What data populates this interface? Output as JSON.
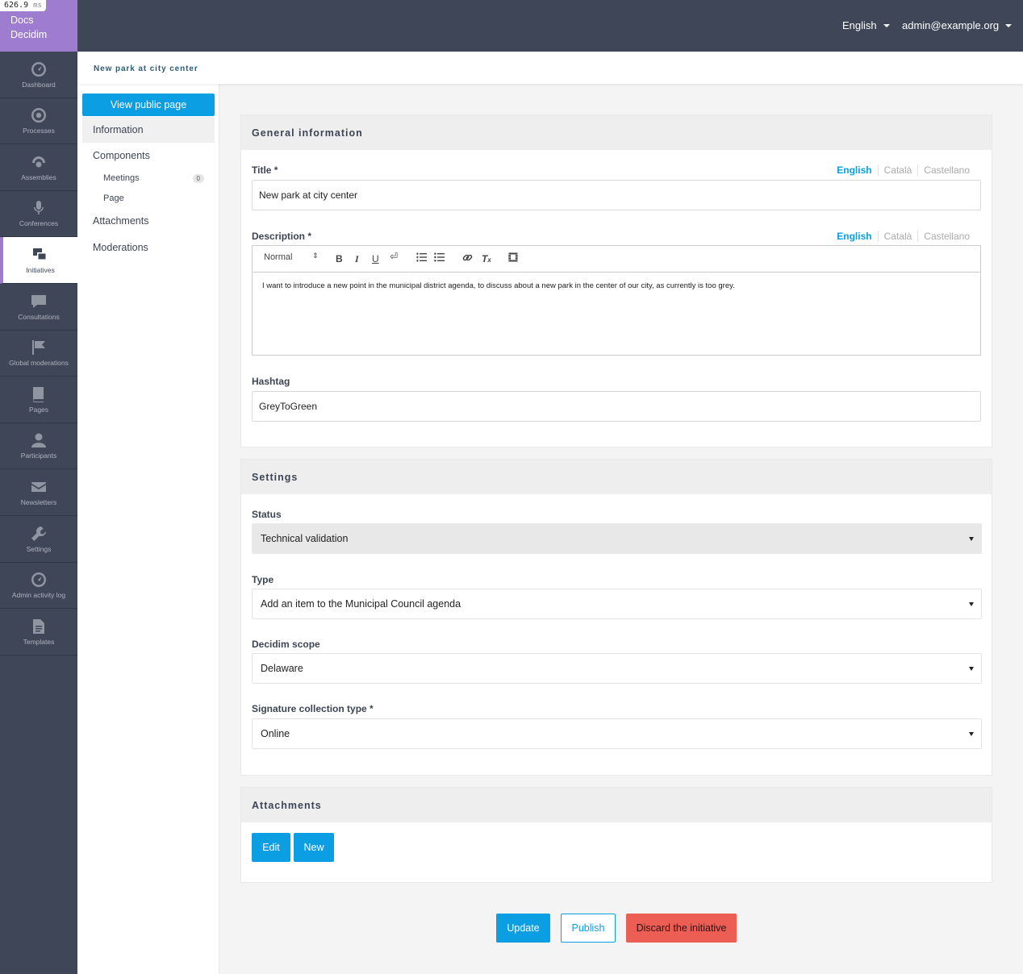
{
  "timing": {
    "value": "626.9",
    "unit": "ms"
  },
  "brand": {
    "line1": "Docs",
    "line2": "Decidim"
  },
  "rail": [
    {
      "label": "Dashboard",
      "icon": "dashboard-icon"
    },
    {
      "label": "Processes",
      "icon": "target-icon"
    },
    {
      "label": "Assemblies",
      "icon": "assembly-icon"
    },
    {
      "label": "Conferences",
      "icon": "microphone-icon"
    },
    {
      "label": "Initiatives",
      "icon": "initiatives-icon",
      "active": true
    },
    {
      "label": "Consultations",
      "icon": "chat-icon"
    },
    {
      "label": "Global moderations",
      "icon": "flag-icon"
    },
    {
      "label": "Pages",
      "icon": "book-icon"
    },
    {
      "label": "Participants",
      "icon": "person-icon"
    },
    {
      "label": "Newsletters",
      "icon": "envelope-icon"
    },
    {
      "label": "Settings",
      "icon": "wrench-icon"
    },
    {
      "label": "Admin activity log",
      "icon": "dashboard-icon"
    },
    {
      "label": "Templates",
      "icon": "document-icon"
    }
  ],
  "topbar": {
    "language": "English",
    "user": "admin@example.org"
  },
  "breadcrumb": "New park at city center",
  "subnav": {
    "public_button": "View public page",
    "information": "Information",
    "components": "Components",
    "meetings": "Meetings",
    "meetings_count": "0",
    "page": "Page",
    "attachments": "Attachments",
    "moderations": "Moderations"
  },
  "general": {
    "heading": "General information",
    "title_label": "Title *",
    "title_value": "New park at city center",
    "description_label": "Description *",
    "languages": [
      "English",
      "Català",
      "Castellano"
    ],
    "editor_format": "Normal",
    "description_value": "I want to introduce a new point in the municipal district agenda, to discuss about a new park in the center of our city, as currently is too grey.",
    "hashtag_label": "Hashtag",
    "hashtag_value": "GreyToGreen"
  },
  "settings": {
    "heading": "Settings",
    "status_label": "Status",
    "status_value": "Technical validation",
    "type_label": "Type",
    "type_value": "Add an item to the Municipal Council agenda",
    "scope_label": "Decidim scope",
    "scope_value": "Delaware",
    "signature_label": "Signature collection type *",
    "signature_value": "Online"
  },
  "attachments": {
    "heading": "Attachments",
    "edit": "Edit",
    "new": "New"
  },
  "actions": {
    "update": "Update",
    "publish": "Publish",
    "discard": "Discard the initiative"
  },
  "colors": {
    "primary": "#0c9ee3",
    "brand": "#9e7ccf",
    "rail": "#3e4658",
    "danger": "#ec5e54"
  }
}
